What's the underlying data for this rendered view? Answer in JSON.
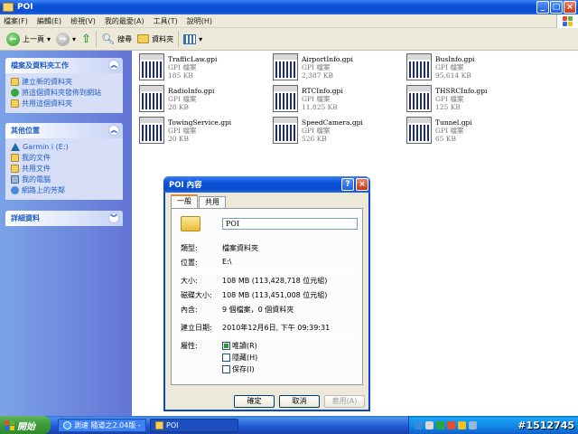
{
  "window": {
    "title": "POI"
  },
  "menu": [
    "檔案(F)",
    "編輯(E)",
    "檢視(V)",
    "我的最愛(A)",
    "工具(T)",
    "說明(H)"
  ],
  "toolbar": {
    "back": "上一頁",
    "search": "搜尋",
    "folders": "資料夾"
  },
  "left_panel": {
    "tasks": {
      "title": "檔案及資料夾工作",
      "items": [
        "建立新的資料夾",
        "將這個資料夾發佈到網站",
        "共用這個資料夾"
      ]
    },
    "places": {
      "title": "其他位置",
      "items": [
        "Garmin    i (E:)",
        "我的文件",
        "共用文件",
        "我的電腦",
        "網路上的芳鄰"
      ]
    },
    "details": {
      "title": "詳細資料"
    }
  },
  "files": [
    {
      "name": "TrafficLaw.gpi",
      "type": "GPI 檔案",
      "size": "185 KB"
    },
    {
      "name": "AirportInfo.gpi",
      "type": "GPI 檔案",
      "size": "2,387 KB"
    },
    {
      "name": "BusInfo.gpi",
      "type": "GPI 檔案",
      "size": "95,614 KB"
    },
    {
      "name": "RadioInfo.gpi",
      "type": "GPI 檔案",
      "size": "28 KB"
    },
    {
      "name": "RTCInfo.gpi",
      "type": "GPI 檔案",
      "size": "11,825 KB"
    },
    {
      "name": "THSRCInfo.gpi",
      "type": "GPI 檔案",
      "size": "125 KB"
    },
    {
      "name": "TowingService.gpi",
      "type": "GPI 檔案",
      "size": "20 KB"
    },
    {
      "name": "SpeedCamera.gpi",
      "type": "GPI 檔案",
      "size": "526 KB"
    },
    {
      "name": "Tunnel.gpi",
      "type": "GPI 檔案",
      "size": "65 KB"
    }
  ],
  "dialog": {
    "title": "POI 內容",
    "tabs": [
      "一般",
      "共用"
    ],
    "name_value": "POI",
    "props": [
      {
        "k": "類型:",
        "v": "檔案資料夾"
      },
      {
        "k": "位置:",
        "v": "E:\\"
      },
      {
        "k": "大小:",
        "v": "108 MB (113,428,718 位元組)"
      },
      {
        "k": "磁碟大小:",
        "v": "108 MB (113,451,008 位元組)"
      },
      {
        "k": "內含:",
        "v": "9 個檔案，0 個資料夾"
      },
      {
        "k": "建立日期:",
        "v": "2010年12月6日, 下午 09:39:31"
      }
    ],
    "attr_label": "屬性:",
    "attrs": [
      {
        "label": "唯讀(R)",
        "checked": true
      },
      {
        "label": "隱藏(H)",
        "checked": false
      },
      {
        "label": "保存(I)",
        "checked": false
      }
    ],
    "buttons": {
      "ok": "確定",
      "cancel": "取消",
      "apply": "套用(A)"
    }
  },
  "taskbar": {
    "start": "開始",
    "tasks": [
      "測速 隨道之2.04版 -...",
      "POI"
    ]
  },
  "watermark": "#1512745"
}
